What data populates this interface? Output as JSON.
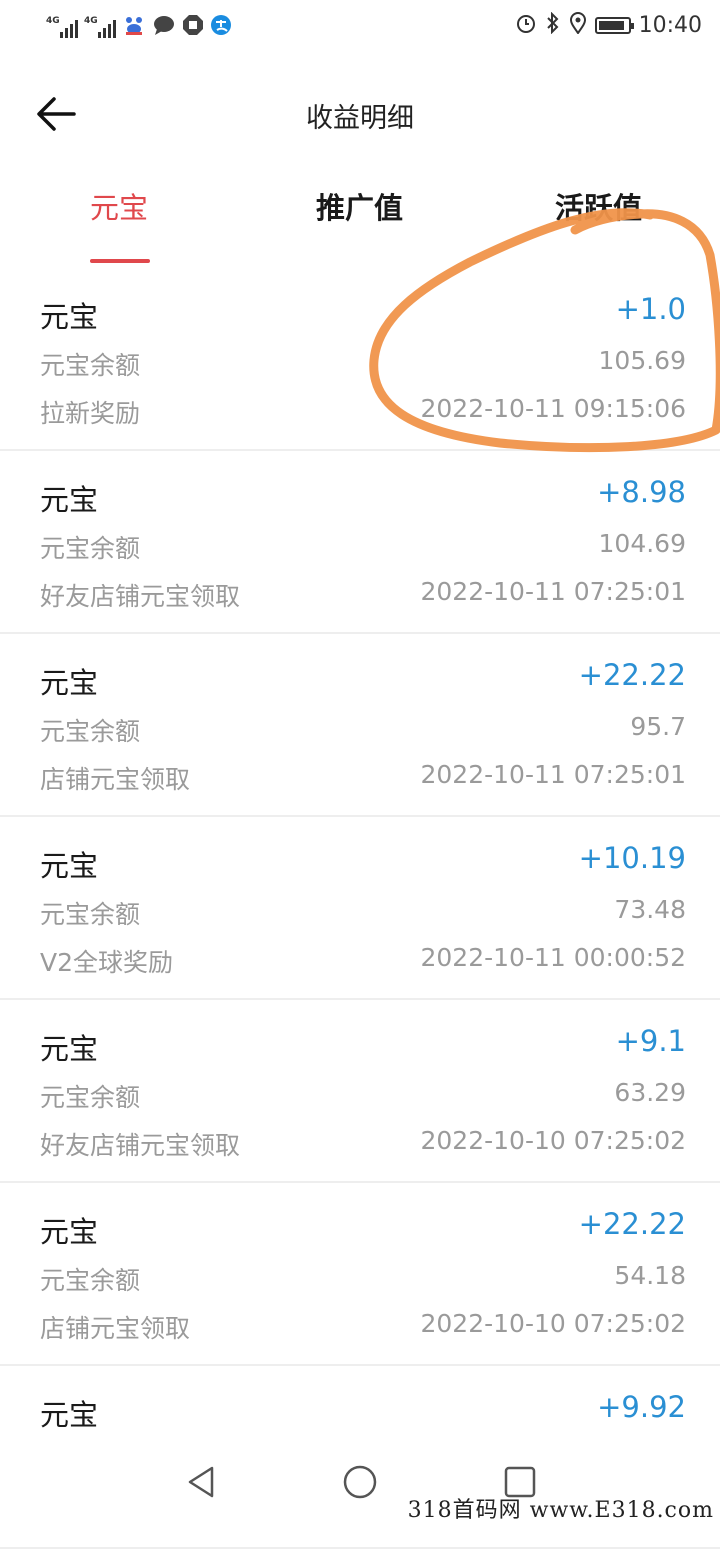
{
  "status_bar": {
    "signal_1_label": "4G",
    "signal_2_label": "4G",
    "time": "10:40",
    "battery_level": 0.9,
    "icons": [
      "baidu-icon",
      "chat-bubble-icon",
      "stop-icon",
      "pay-icon",
      "alarm-icon",
      "bluetooth-icon",
      "location-icon",
      "battery-icon"
    ]
  },
  "header": {
    "title": "收益明细",
    "back_icon": "arrow-left-icon"
  },
  "tabs": [
    {
      "label": "元宝"
    },
    {
      "label": "推广值"
    },
    {
      "label": "活跃值"
    }
  ],
  "active_tab": 0,
  "records": [
    {
      "name": "元宝",
      "amount": "+1.0",
      "balance_label": "元宝余额",
      "balance": "105.69",
      "reason": "拉新奖励",
      "time": "2022-10-11 09:15:06"
    },
    {
      "name": "元宝",
      "amount": "+8.98",
      "balance_label": "元宝余额",
      "balance": "104.69",
      "reason": "好友店铺元宝领取",
      "time": "2022-10-11 07:25:01"
    },
    {
      "name": "元宝",
      "amount": "+22.22",
      "balance_label": "元宝余额",
      "balance": "95.7",
      "reason": "店铺元宝领取",
      "time": "2022-10-11 07:25:01"
    },
    {
      "name": "元宝",
      "amount": "+10.19",
      "balance_label": "元宝余额",
      "balance": "73.48",
      "reason": "V2全球奖励",
      "time": "2022-10-11 00:00:52"
    },
    {
      "name": "元宝",
      "amount": "+9.1",
      "balance_label": "元宝余额",
      "balance": "63.29",
      "reason": "好友店铺元宝领取",
      "time": "2022-10-10 07:25:02"
    },
    {
      "name": "元宝",
      "amount": "+22.22",
      "balance_label": "元宝余额",
      "balance": "54.18",
      "reason": "店铺元宝领取",
      "time": "2022-10-10 07:25:02"
    },
    {
      "name": "元宝",
      "amount": "+9.92",
      "balance_label": "",
      "balance": "",
      "reason": "",
      "time": ""
    }
  ],
  "nav_bar": {
    "icons": [
      "back-triangle-icon",
      "home-circle-icon",
      "recents-square-icon"
    ]
  },
  "watermark": "318首码网 www.E318.com",
  "colors": {
    "accent_red": "#e0484c",
    "amount_blue": "#2a8fd3",
    "secondary_text": "#9a9a9a",
    "annotation_orange": "#f0944a"
  }
}
